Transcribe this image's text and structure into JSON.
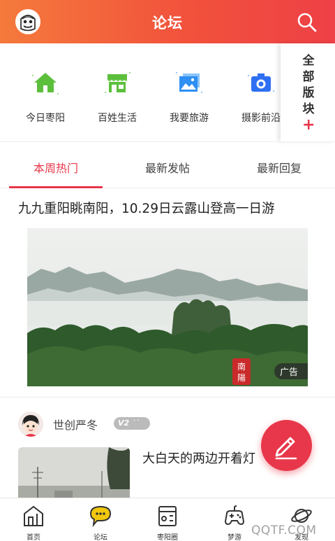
{
  "header": {
    "title": "论坛",
    "search_icon": "search-icon",
    "avatar_icon": "meme-face-avatar"
  },
  "categories": [
    {
      "label": "今日枣阳",
      "icon": "home-icon",
      "color": "#5cbf3c"
    },
    {
      "label": "百姓生活",
      "icon": "shop-icon",
      "color": "#5cbf3c"
    },
    {
      "label": "我要旅游",
      "icon": "photo-icon",
      "color": "#2f8ff2"
    },
    {
      "label": "摄影前沿",
      "icon": "camera-icon",
      "color": "#2f6ff2"
    }
  ],
  "all_sections": {
    "label": "全部版块",
    "plus": "+"
  },
  "tabs": [
    {
      "label": "本周热门",
      "active": true
    },
    {
      "label": "最新发帖",
      "active": false
    },
    {
      "label": "最新回复",
      "active": false
    }
  ],
  "featured_post": {
    "title": "九九重阳眺南阳，10.29日云露山登高一日游",
    "ad_label": "广告",
    "seal_text": "南陽"
  },
  "second_post": {
    "user_name": "世创严冬",
    "level": "V2",
    "title": "大白天的两边开着灯"
  },
  "fab": {
    "icon": "pencil-icon"
  },
  "bottom_nav": [
    {
      "label": "首页",
      "icon": "home-outline-icon"
    },
    {
      "label": "论坛",
      "icon": "chat-bubble-icon"
    },
    {
      "label": "枣阳圈",
      "icon": "grid-box-icon"
    },
    {
      "label": "梦游",
      "icon": "gamepad-icon"
    },
    {
      "label": "发现",
      "icon": "planet-icon"
    }
  ],
  "watermark": "QQTF.COM",
  "colors": {
    "accent": "#e8374a",
    "header_start": "#f47a3c",
    "header_end": "#ee4046"
  }
}
